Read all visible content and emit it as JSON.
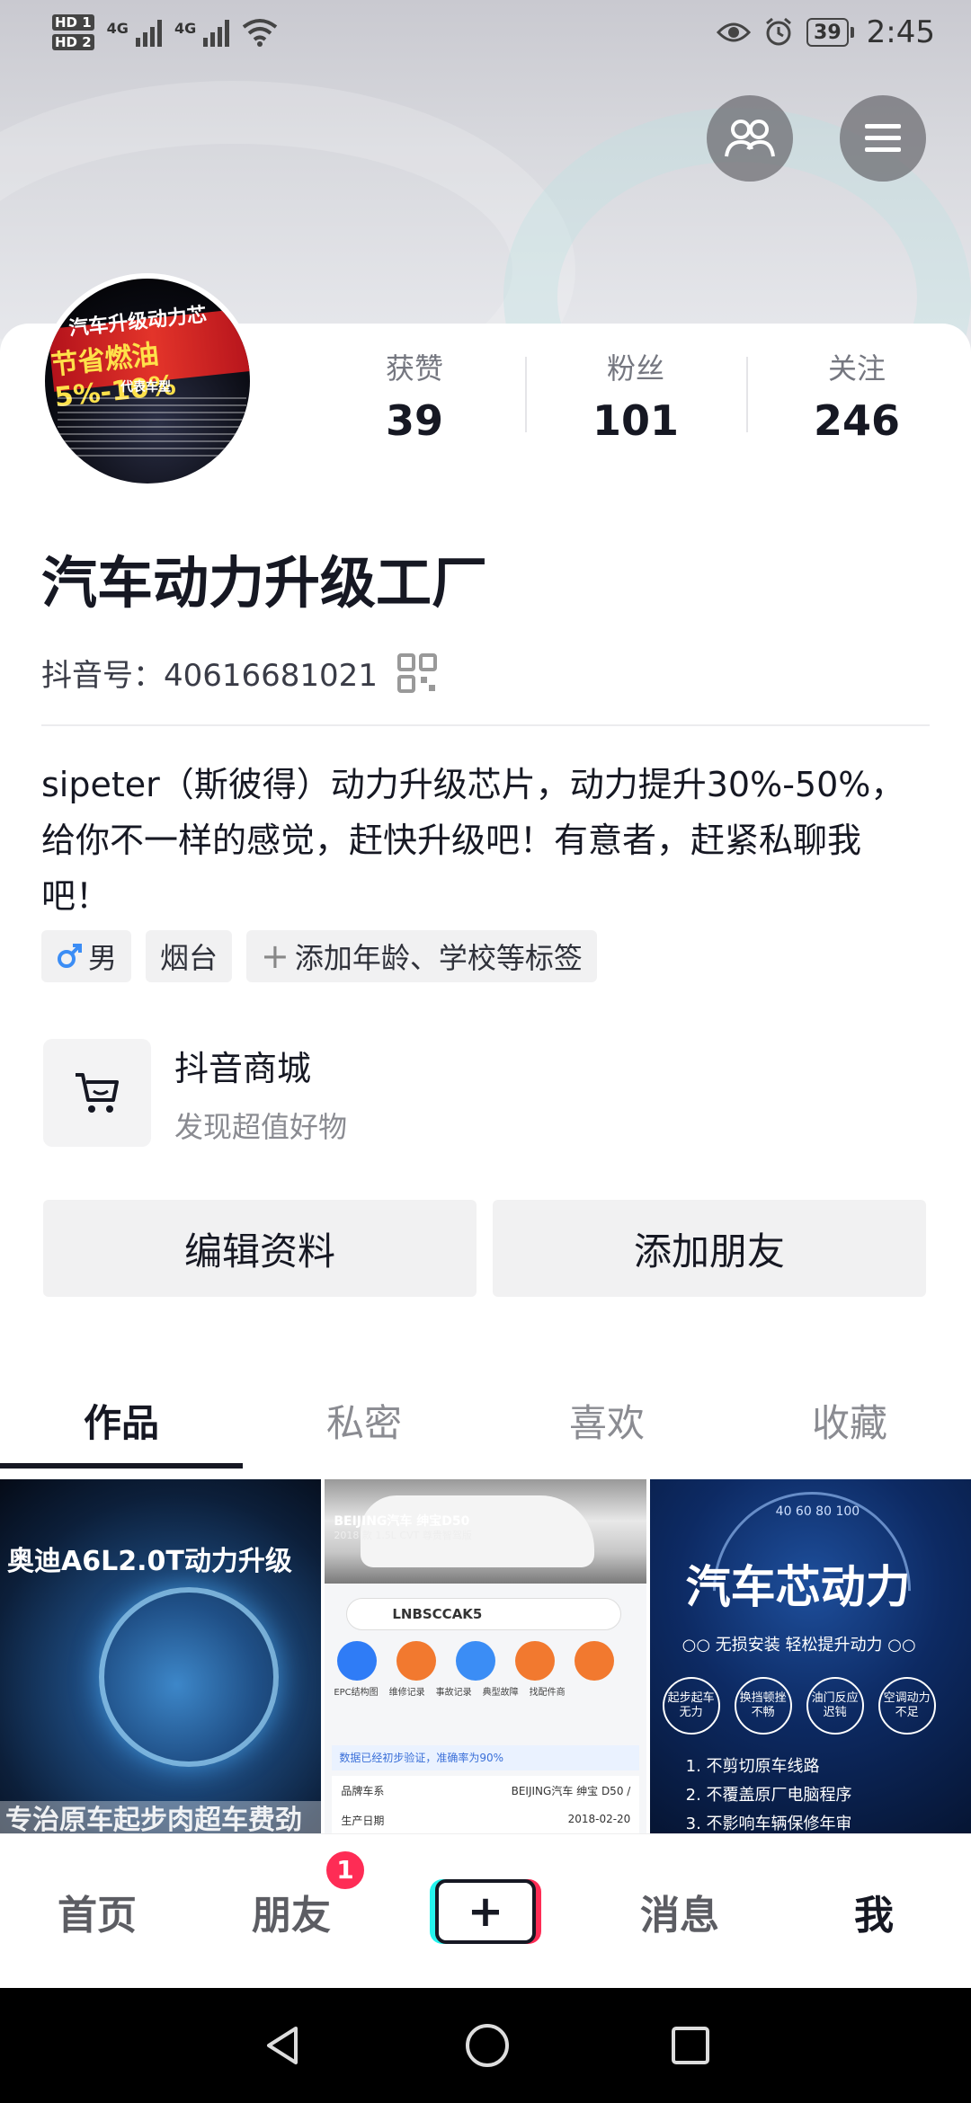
{
  "status_bar": {
    "hd1": "HD 1",
    "hd2": "HD 2",
    "net1": "4G",
    "net2": "4G",
    "battery": "39",
    "time": "2:45"
  },
  "top_buttons": {
    "friends_icon": "friends-icon",
    "menu_icon": "menu-icon"
  },
  "profile": {
    "avatar_text": {
      "line1": "汽车升级动力芯",
      "line2": "节省燃油5%-10%",
      "line3": "代表车型"
    },
    "stats": [
      {
        "label": "获赞",
        "value": "39"
      },
      {
        "label": "粉丝",
        "value": "101"
      },
      {
        "label": "关注",
        "value": "246"
      }
    ],
    "name": "汽车动力升级工厂",
    "douyin_id_label": "抖音号：",
    "douyin_id": "40616681021",
    "bio": "sipeter（斯彼得）动力升级芯片，动力提升30%-50%，给你不一样的感觉，赶快升级吧！有意者，赶紧私聊我吧！",
    "tags": {
      "gender": "男",
      "city": "烟台",
      "add": "添加年龄、学校等标签"
    }
  },
  "shop": {
    "title": "抖音商城",
    "subtitle": "发现超值好物"
  },
  "actions": {
    "edit": "编辑资料",
    "add_friend": "添加朋友"
  },
  "tabs": [
    {
      "label": "作品",
      "active": true
    },
    {
      "label": "私密",
      "active": false
    },
    {
      "label": "喜欢",
      "active": false
    },
    {
      "label": "收藏",
      "active": false
    }
  ],
  "thumbnails": [
    {
      "title": "奥迪A6L2.0T动力升级",
      "bottom": "专治原车起步肉超车费劲"
    },
    {
      "car_title": "BEIJING汽车 绅宝D50",
      "car_sub": "2018 款 1.5L CVT 尊贵智驾版",
      "vin": "LNBSCCAK5",
      "icon_labels": [
        "EPC结构图",
        "维修记录",
        "事故记录",
        "典型故障",
        "找配件商"
      ],
      "notice": "数据已经初步验证，准确率为90%",
      "rows": [
        {
          "k": "品牌车系",
          "v": "BEIJING汽车 绅宝 D50 /"
        },
        {
          "k": "生产日期",
          "v": "2018-02-20"
        }
      ]
    },
    {
      "nums": "40  60  80  100",
      "title": "汽车芯动力",
      "sub": "○○ 无损安装  轻松提升动力 ○○",
      "circles": [
        "起步起车无力",
        "换挡顿挫不畅",
        "油门反应迟钝",
        "空调动力不足"
      ],
      "list": [
        "1. 不剪切原车线路",
        "2. 不覆盖原厂电脑程序",
        "3. 不影响车辆保修年审"
      ]
    }
  ],
  "bottom_nav": {
    "home": "首页",
    "friends": "朋友",
    "friends_badge": "1",
    "create": "+",
    "messages": "消息",
    "me": "我"
  },
  "colors": {
    "accent_red": "#fe2c55",
    "accent_cyan": "#25f4ee",
    "text_primary": "#161823",
    "text_secondary": "#8a8b91"
  }
}
